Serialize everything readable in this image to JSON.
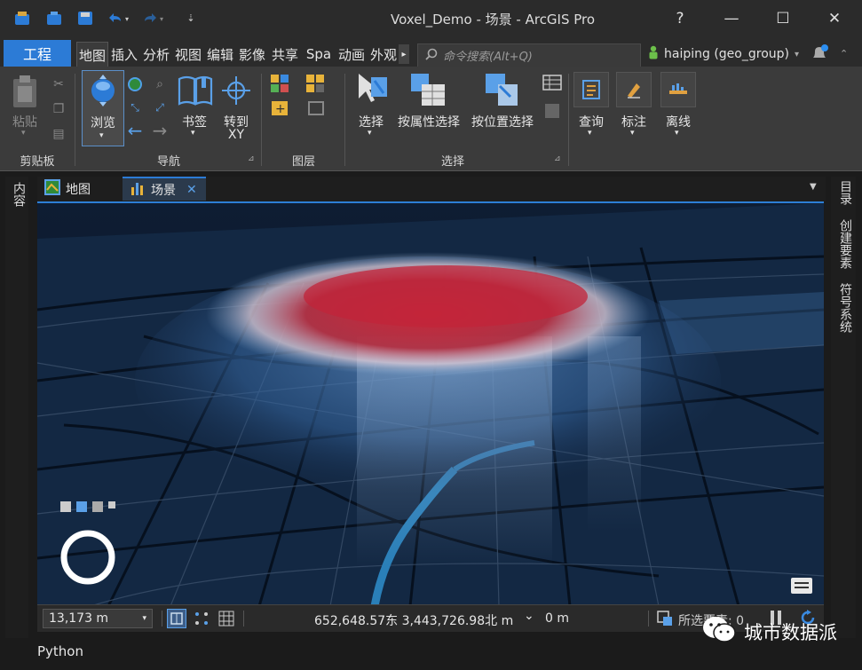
{
  "window": {
    "title": "Voxel_Demo - 场景 - ArcGIS Pro",
    "help": "?",
    "minimize": "—",
    "maximize": "☐",
    "close": "✕"
  },
  "tabs": {
    "project": "工程",
    "items": [
      "地图",
      "插入",
      "分析",
      "视图",
      "编辑",
      "影像",
      "共享",
      "Spa",
      "动画",
      "外观"
    ],
    "more": "▸"
  },
  "search": {
    "placeholder": "命令搜索(Alt+Q)"
  },
  "user": {
    "name": "haiping (geo_group)",
    "caret": "▾"
  },
  "ribbon": {
    "clipboard": {
      "label": "剪贴板",
      "paste": "粘贴"
    },
    "navigate": {
      "label": "导航",
      "explore": "浏览",
      "bookmarks": "书签",
      "goto": "转到",
      "goto2": "XY"
    },
    "layer": {
      "label": "图层"
    },
    "selection": {
      "label": "选择",
      "select": "选择",
      "by_attr": "按属性选择",
      "by_loc": "按位置选择"
    },
    "inquiry": {
      "query": "查询",
      "label_btn": "标注",
      "offline": "离线"
    }
  },
  "doc_tabs": [
    {
      "label": "地图"
    },
    {
      "label": "场景",
      "close": "✕"
    }
  ],
  "left_dock": {
    "contents": "内容"
  },
  "right_dock": {
    "catalog": "目录",
    "create": "创建要素",
    "symbology": "符号系统"
  },
  "status": {
    "scale": "13,173 m",
    "coords": "652,648.57东 3,443,726.98北 m",
    "elevation": "0 m",
    "selected": "所选要素: 0"
  },
  "python": "Python",
  "watermark": "城市数据派",
  "colors": {
    "accent": "#2c7bd6",
    "ribbon": "#3b3b3b",
    "titlebar": "#2b2b2b"
  }
}
